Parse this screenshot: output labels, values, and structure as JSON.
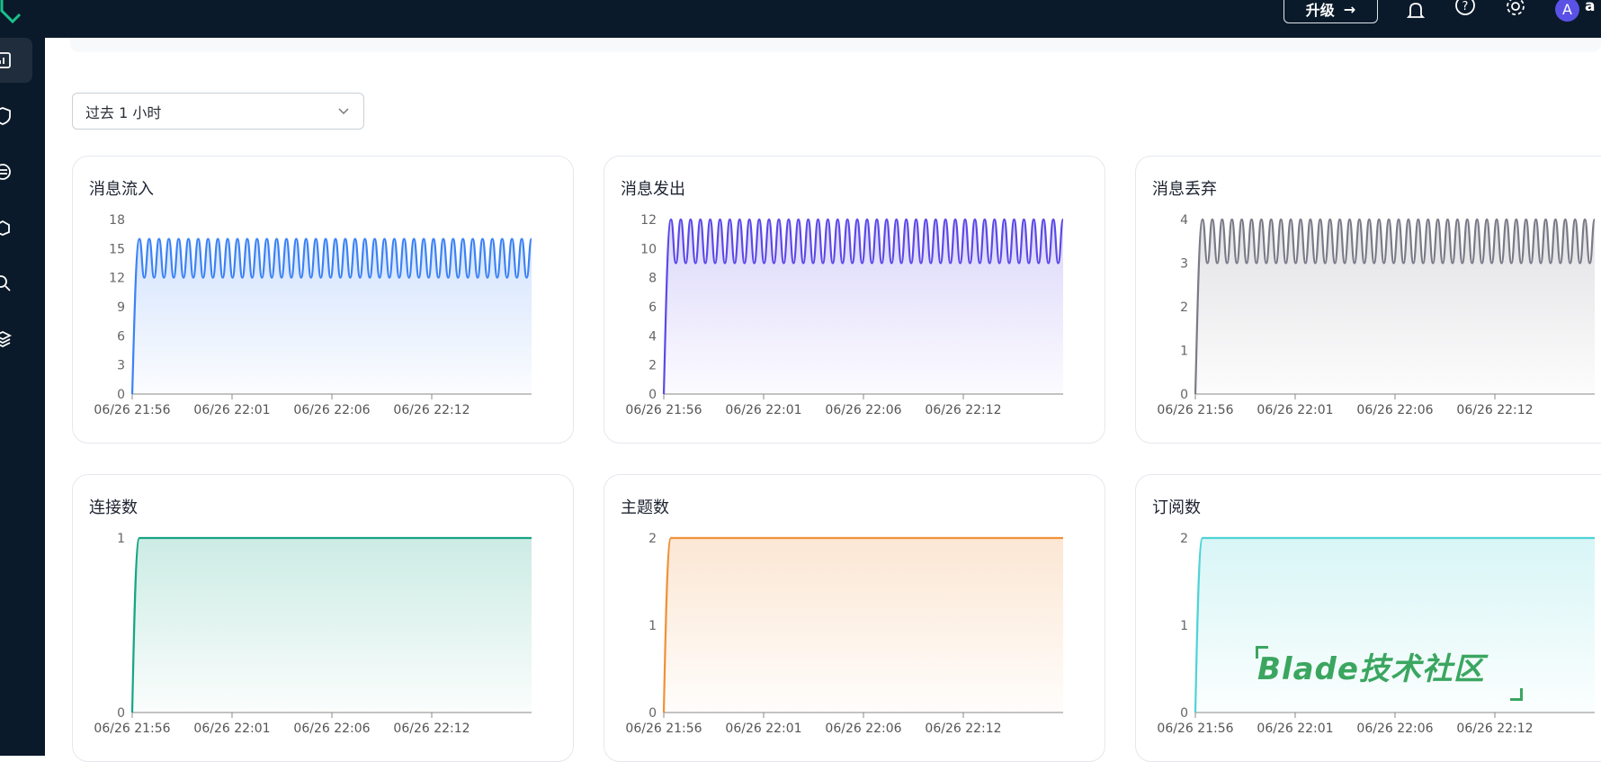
{
  "header": {
    "upgrade_label": "升级",
    "avatar_initial": "A",
    "user_name": "a"
  },
  "filter": {
    "time_range": "过去 1 小时"
  },
  "watermark": "Blade技术社区",
  "colors": {
    "blue": "#3b82f6",
    "purple": "#5b49e8",
    "gray": "#7a7a88",
    "green": "#17a584",
    "orange": "#f0913a",
    "cyan": "#4fd3d6"
  },
  "chart_data": [
    {
      "type": "line",
      "title": "消息流入",
      "color": "#3b82f6",
      "ylim": [
        0,
        18
      ],
      "yticks": [
        "0",
        "3",
        "6",
        "9",
        "12",
        "15",
        "18"
      ],
      "xticks": [
        "06/26 21:56",
        "06/26 22:01",
        "06/26 22:06",
        "06/26 22:12"
      ],
      "pattern": {
        "min": 12,
        "max": 16,
        "cycles": 40
      }
    },
    {
      "type": "line",
      "title": "消息发出",
      "color": "#5b49e8",
      "ylim": [
        0,
        12
      ],
      "yticks": [
        "0",
        "2",
        "4",
        "6",
        "8",
        "10",
        "12"
      ],
      "xticks": [
        "06/26 21:56",
        "06/26 22:01",
        "06/26 22:06",
        "06/26 22:12"
      ],
      "pattern": {
        "min": 9,
        "max": 12,
        "cycles": 40
      }
    },
    {
      "type": "line",
      "title": "消息丢弃",
      "color": "#7a7a88",
      "ylim": [
        0,
        4
      ],
      "yticks": [
        "0",
        "1",
        "2",
        "3",
        "4"
      ],
      "xticks": [
        "06/26 21:56",
        "06/26 22:01",
        "06/26 22:06",
        "06/26 22:12"
      ],
      "pattern": {
        "min": 3,
        "max": 4,
        "cycles": 40
      }
    },
    {
      "type": "line",
      "title": "连接数",
      "color": "#17a584",
      "ylim": [
        0,
        1
      ],
      "yticks": [
        "0",
        "1"
      ],
      "xticks": [
        "06/26 21:56",
        "06/26 22:01",
        "06/26 22:06",
        "06/26 22:12"
      ],
      "pattern": {
        "min": 1,
        "max": 1,
        "cycles": 0
      }
    },
    {
      "type": "line",
      "title": "主题数",
      "color": "#f0913a",
      "ylim": [
        0,
        2
      ],
      "yticks": [
        "0",
        "1",
        "2"
      ],
      "xticks": [
        "06/26 21:56",
        "06/26 22:01",
        "06/26 22:06",
        "06/26 22:12"
      ],
      "pattern": {
        "min": 2,
        "max": 2,
        "cycles": 0
      }
    },
    {
      "type": "line",
      "title": "订阅数",
      "color": "#4fd3d6",
      "ylim": [
        0,
        2
      ],
      "yticks": [
        "0",
        "1",
        "2"
      ],
      "xticks": [
        "06/26 21:56",
        "06/26 22:01",
        "06/26 22:06",
        "06/26 22:12"
      ],
      "pattern": {
        "min": 2,
        "max": 2,
        "cycles": 0
      }
    }
  ]
}
